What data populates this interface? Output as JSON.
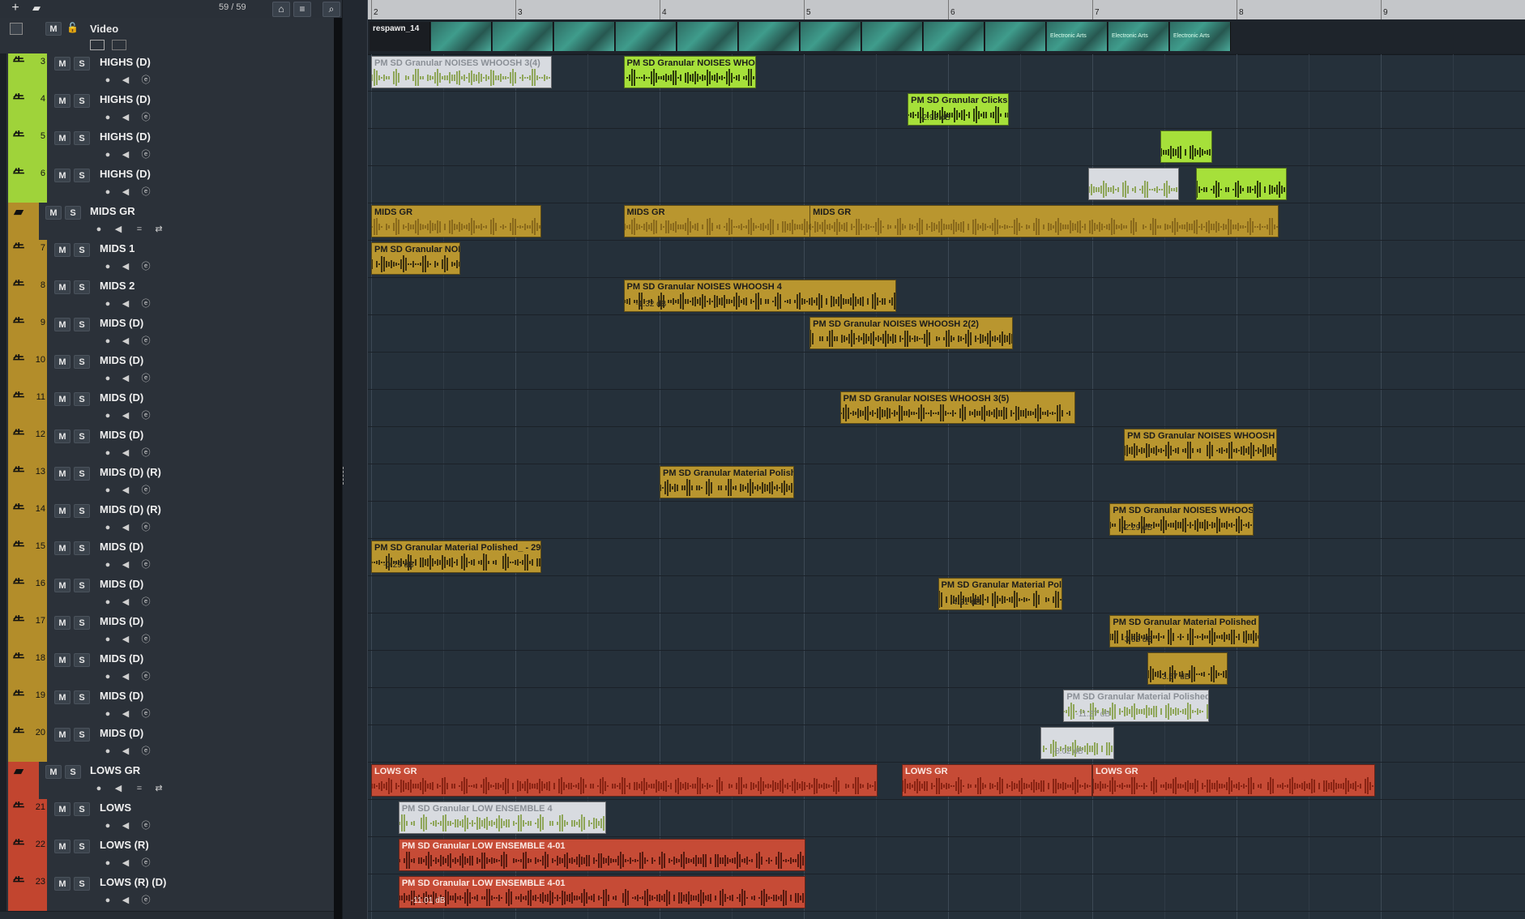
{
  "toolbar": {
    "add_icon": "plus-icon",
    "add_folder_icon": "add-folder-icon",
    "track_count": "59 / 59",
    "home_icon": "home-icon",
    "list_icon": "list-icon",
    "search_icon": "search-icon"
  },
  "video_track": {
    "name": "Video",
    "mute_label": "M"
  },
  "buttons": {
    "mute": "M",
    "solo": "S"
  },
  "tracks": [
    {
      "num": "3",
      "name": "HIGHS (D)",
      "color": "#9fd33a"
    },
    {
      "num": "4",
      "name": "HIGHS (D)",
      "color": "#9fd33a"
    },
    {
      "num": "5",
      "name": "HIGHS (D)",
      "color": "#9fd33a"
    },
    {
      "num": "6",
      "name": "HIGHS (D)",
      "color": "#9fd33a"
    },
    {
      "num": "",
      "name": "MIDS GR",
      "color": "#b38d2a",
      "group": true
    },
    {
      "num": "7",
      "name": "MIDS 1",
      "color": "#b38d2a"
    },
    {
      "num": "8",
      "name": "MIDS 2",
      "color": "#b38d2a"
    },
    {
      "num": "9",
      "name": "MIDS (D)",
      "color": "#b38d2a"
    },
    {
      "num": "10",
      "name": "MIDS (D)",
      "color": "#b38d2a"
    },
    {
      "num": "11",
      "name": "MIDS (D)",
      "color": "#b38d2a"
    },
    {
      "num": "12",
      "name": "MIDS (D)",
      "color": "#b38d2a"
    },
    {
      "num": "13",
      "name": "MIDS (D) (R)",
      "color": "#b38d2a"
    },
    {
      "num": "14",
      "name": "MIDS (D) (R)",
      "color": "#b38d2a"
    },
    {
      "num": "15",
      "name": "MIDS (D)",
      "color": "#b38d2a"
    },
    {
      "num": "16",
      "name": "MIDS (D)",
      "color": "#b38d2a"
    },
    {
      "num": "17",
      "name": "MIDS (D)",
      "color": "#b38d2a"
    },
    {
      "num": "18",
      "name": "MIDS (D)",
      "color": "#b38d2a"
    },
    {
      "num": "19",
      "name": "MIDS (D)",
      "color": "#b38d2a"
    },
    {
      "num": "20",
      "name": "MIDS (D)",
      "color": "#b38d2a"
    },
    {
      "num": "",
      "name": "LOWS GR",
      "color": "#c2452f",
      "group": true
    },
    {
      "num": "21",
      "name": "LOWS",
      "color": "#c2452f"
    },
    {
      "num": "22",
      "name": "LOWS (R)",
      "color": "#c2452f"
    },
    {
      "num": "23",
      "name": "LOWS (R) (D)",
      "color": "#c2452f"
    }
  ],
  "ruler_bars": [
    "2",
    "3",
    "4",
    "5",
    "6",
    "7",
    "8",
    "9"
  ],
  "video_clips": [
    "respawn_14",
    "",
    "",
    "",
    "",
    "",
    "",
    "",
    "",
    "",
    "",
    "Electronic Arts",
    "Electronic Arts",
    "Electronic Arts"
  ],
  "events": [
    {
      "row": 0,
      "bar": 2.0,
      "len": 1.25,
      "name": "PM SD Granular NOISES WHOOSH 3(4)",
      "db": "",
      "style": "muted"
    },
    {
      "row": 0,
      "bar": 3.75,
      "len": 0.92,
      "name": "PM SD Granular NOISES WHO",
      "db": "",
      "style": "green"
    },
    {
      "row": 1,
      "bar": 5.72,
      "len": 0.7,
      "name": "PM SD Granular Clicks",
      "db": "-2.93 dB",
      "style": "green"
    },
    {
      "row": 2,
      "bar": 7.47,
      "len": 0.36,
      "name": "",
      "db": "",
      "style": "green"
    },
    {
      "row": 3,
      "bar": 6.97,
      "len": 0.63,
      "name": "",
      "db": "",
      "style": "muted"
    },
    {
      "row": 3,
      "bar": 7.72,
      "len": 0.63,
      "name": "",
      "db": "",
      "style": "green"
    },
    {
      "row": 4,
      "bar": 2.0,
      "len": 1.18,
      "name": "MIDS GR",
      "db": "",
      "style": "grp-gold"
    },
    {
      "row": 4,
      "bar": 3.75,
      "len": 1.3,
      "name": "MIDS GR",
      "db": "",
      "style": "grp-gold"
    },
    {
      "row": 4,
      "bar": 5.04,
      "len": 3.25,
      "name": "MIDS GR",
      "db": "",
      "style": "grp-gold"
    },
    {
      "row": 5,
      "bar": 2.0,
      "len": 0.62,
      "name": "PM SD Granular NOI",
      "db": "",
      "style": "gold"
    },
    {
      "row": 6,
      "bar": 3.75,
      "len": 1.89,
      "name": "PM SD Granular NOISES WHOOSH 4",
      "db": "-1.32 dB",
      "style": "gold"
    },
    {
      "row": 7,
      "bar": 5.04,
      "len": 1.41,
      "name": "PM SD Granular NOISES WHOOSH 2(2)",
      "db": "",
      "style": "gold"
    },
    {
      "row": 9,
      "bar": 5.25,
      "len": 1.63,
      "name": "PM SD Granular NOISES WHOOSH 3(5)",
      "db": "",
      "style": "gold"
    },
    {
      "row": 10,
      "bar": 7.22,
      "len": 1.06,
      "name": "PM SD Granular NOISES WHOOSH",
      "db": "",
      "style": "gold"
    },
    {
      "row": 11,
      "bar": 4.0,
      "len": 0.93,
      "name": "PM SD Granular Material Polish",
      "db": "",
      "style": "gold"
    },
    {
      "row": 12,
      "bar": 7.12,
      "len": 1.0,
      "name": "PM SD Granular NOISES WHOOS",
      "db": "-2.29 dB",
      "style": "gold"
    },
    {
      "row": 13,
      "bar": 2.0,
      "len": 1.18,
      "name": "PM SD Granular Material Polished_ - 29",
      "db": "-0.29 dB",
      "style": "gold"
    },
    {
      "row": 14,
      "bar": 5.93,
      "len": 0.86,
      "name": "PM SD Granular Material Pol",
      "db": "-4.21 dB",
      "style": "gold"
    },
    {
      "row": 15,
      "bar": 7.12,
      "len": 1.04,
      "name": "PM SD Granular Material Polished",
      "db": "-3.58 dB",
      "style": "gold"
    },
    {
      "row": 16,
      "bar": 7.38,
      "len": 0.56,
      "name": "",
      "db": "-3.57 dB",
      "style": "gold"
    },
    {
      "row": 17,
      "bar": 6.8,
      "len": 1.01,
      "name": "PM SD Granular Material Polished",
      "db": "-11.27 dB",
      "style": "muted"
    },
    {
      "row": 18,
      "bar": 6.64,
      "len": 0.51,
      "name": "",
      "db": "-8.02 dB",
      "style": "muted"
    },
    {
      "row": 19,
      "bar": 2.0,
      "len": 3.51,
      "name": "LOWS GR",
      "db": "",
      "style": "grp-red"
    },
    {
      "row": 19,
      "bar": 5.68,
      "len": 1.32,
      "name": "LOWS GR",
      "db": "",
      "style": "grp-red"
    },
    {
      "row": 19,
      "bar": 7.0,
      "len": 1.96,
      "name": "LOWS GR",
      "db": "",
      "style": "grp-red"
    },
    {
      "row": 20,
      "bar": 2.19,
      "len": 1.44,
      "name": "PM SD Granular LOW ENSEMBLE 4",
      "db": "",
      "style": "muted"
    },
    {
      "row": 21,
      "bar": 2.19,
      "len": 2.82,
      "name": "PM SD Granular LOW ENSEMBLE 4-01",
      "db": "",
      "style": "red"
    },
    {
      "row": 22,
      "bar": 2.19,
      "len": 2.82,
      "name": "PM SD Granular LOW ENSEMBLE 4-01",
      "db": "-11.01 dB",
      "style": "red"
    }
  ]
}
